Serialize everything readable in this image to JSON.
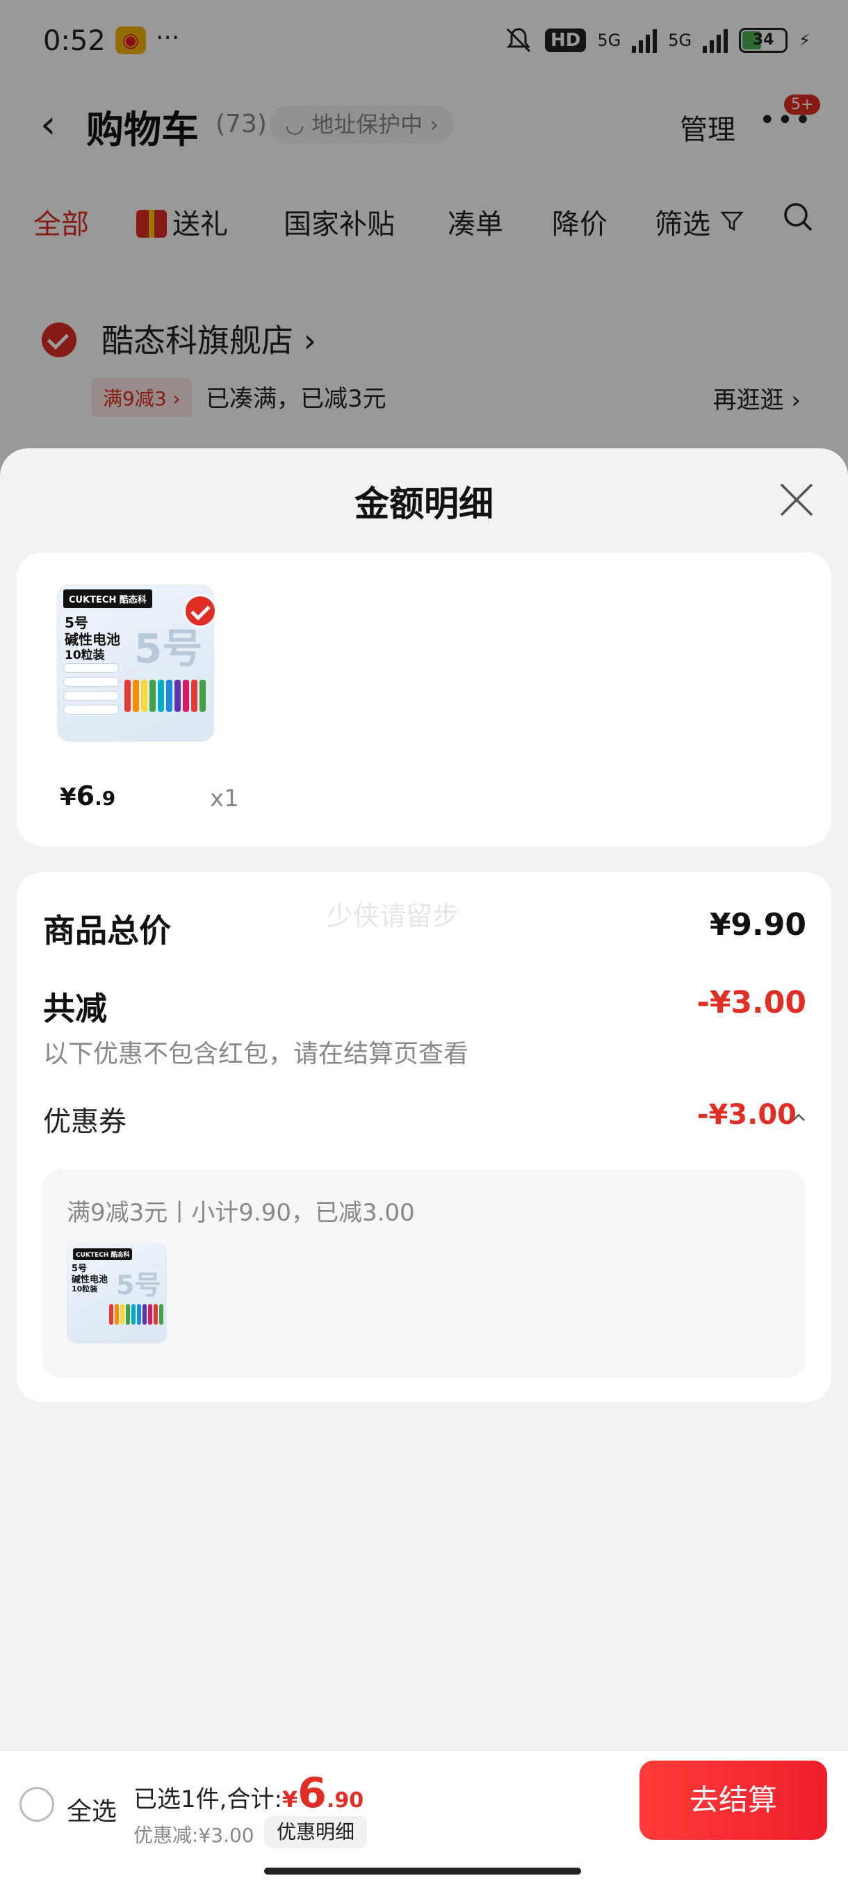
{
  "status_bar": {
    "time": "0:52",
    "network_1": "5G",
    "network_2": "5G",
    "battery": "34",
    "hd": "HD"
  },
  "nav": {
    "title": "购物车",
    "count": "(73)",
    "address_protection": "地址保护中",
    "manage": "管理",
    "message_badge": "5+"
  },
  "tabs": [
    {
      "label": "全部",
      "active": true
    },
    {
      "label": "送礼",
      "icon": "gift-icon"
    },
    {
      "label": "国家补贴"
    },
    {
      "label": "凑单"
    },
    {
      "label": "降价"
    },
    {
      "label": "筛选",
      "icon": "filter-icon"
    }
  ],
  "store": {
    "name": "酷态科旗舰店",
    "promo_tag": "满9减3",
    "promo_text": "已凑满，已减3元",
    "browse_more": "再逛逛"
  },
  "sheet": {
    "title": "金额明细",
    "product": {
      "image_text": {
        "brand": "CUKTECH 酷态科",
        "line1": "5号",
        "line2": "碱性电池",
        "line3": "10粒装",
        "big": "5号"
      },
      "price_symbol": "¥",
      "price_int": "6",
      "price_dec": ".9",
      "quantity": "x1"
    },
    "watermark": "少侠请留步",
    "total_label": "商品总价",
    "total_value": "¥9.90",
    "reduce_label": "共减",
    "reduce_value": "-¥3.00",
    "note": "以下优惠不包含红包，请在结算页查看",
    "coupon_label": "优惠券",
    "coupon_value": "-¥3.00",
    "coupon_desc": "满9减3元丨小计9.90，已减3.00"
  },
  "bottom_bar": {
    "select_all": "全选",
    "summary_prefix": "已选1件,合计:",
    "total_symbol": "¥",
    "total_int": "6",
    "total_dec": ".90",
    "discount": "优惠减:¥3.00",
    "detail_pill": "优惠明细",
    "checkout": "去结算"
  },
  "colors": {
    "accent": "#e02e24",
    "checkout_start": "#ff3b3b",
    "checkout_end": "#f01f2a"
  }
}
